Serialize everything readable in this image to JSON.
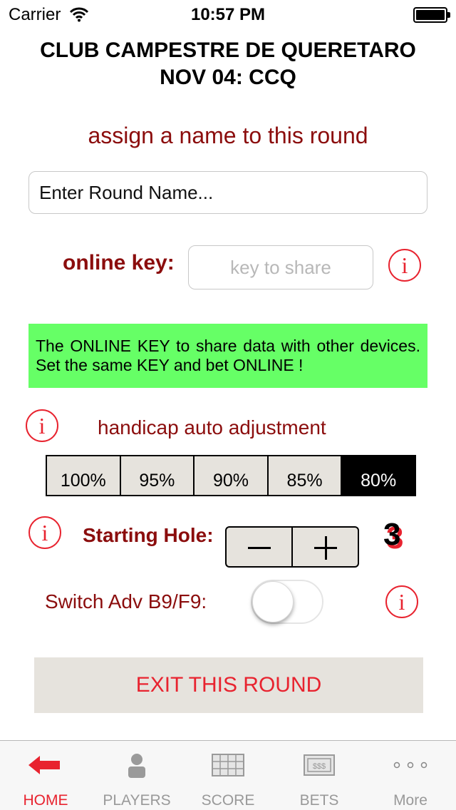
{
  "status_bar": {
    "carrier": "Carrier",
    "time": "10:57 PM"
  },
  "header": {
    "club": "CLUB CAMPESTRE DE QUERETARO",
    "round": "NOV 04: CCQ"
  },
  "round_name": {
    "label": "assign a name to this round",
    "placeholder": "Enter Round Name...",
    "value": ""
  },
  "online_key": {
    "label": "online key:",
    "placeholder": "key to share",
    "info_text": "The ONLINE KEY to share data with other devices. Set  the same KEY and bet ONLINE !"
  },
  "handicap": {
    "label": "handicap auto adjustment",
    "options": [
      "100%",
      "95%",
      "90%",
      "85%",
      "80%"
    ],
    "selected": "80%"
  },
  "starting_hole": {
    "label": "Starting Hole:",
    "value": "3"
  },
  "switch_adv": {
    "label": "Switch Adv B9/F9:",
    "on": false
  },
  "exit_button": {
    "label": "EXIT THIS ROUND"
  },
  "tabs": [
    {
      "label": "HOME",
      "icon": "arrow-left-icon",
      "active": true
    },
    {
      "label": "PLAYERS",
      "icon": "player-icon",
      "active": false
    },
    {
      "label": "SCORE",
      "icon": "scorecard-icon",
      "active": false
    },
    {
      "label": "BETS",
      "icon": "money-icon",
      "active": false
    },
    {
      "label": "More",
      "icon": "more-dots-icon",
      "active": false
    }
  ],
  "colors": {
    "accent": "#e8232f",
    "label": "#8b0d0d",
    "notice_bg": "#66ff66",
    "button_bg": "#e6e3dd"
  }
}
